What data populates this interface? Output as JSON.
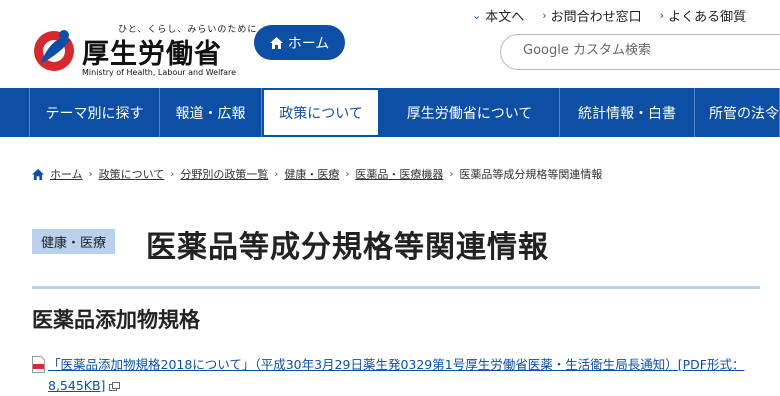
{
  "header": {
    "logo_tagline": "ひと、くらし、みらいのために",
    "logo_name": "厚生労働省",
    "logo_en": "Ministry of Health, Labour and Welfare",
    "home_label": "ホーム",
    "utility_links": [
      "本文へ",
      "お問合わせ窓口",
      "よくある御質"
    ],
    "search_placeholder": "Google カスタム検索"
  },
  "nav": {
    "items": [
      "テーマ別に探す",
      "報道・広報",
      "政策について",
      "厚生労働省について",
      "統計情報・白書",
      "所管の法令"
    ],
    "active_index": 2
  },
  "breadcrumb": [
    "ホーム",
    "政策について",
    "分野別の政策一覧",
    "健康・医療",
    "医薬品・医療機器",
    "医薬品等成分規格等関連情報"
  ],
  "page": {
    "category_tag": "健康・医療",
    "title": "医薬品等成分規格等関連情報",
    "section_title": "医薬品添加物規格",
    "document_link": "「医薬品添加物規格2018について」",
    "document_note_1": "（平成30年3月29日薬生発0329第1号厚生労働省医薬・生活衛生局長通知）",
    "document_link_2": "[PDF形式：8,545KB]"
  },
  "colors": {
    "brand_blue": "#0e4fa6",
    "accent_light_blue": "#b7d1ef",
    "logo_red": "#d7282f"
  }
}
